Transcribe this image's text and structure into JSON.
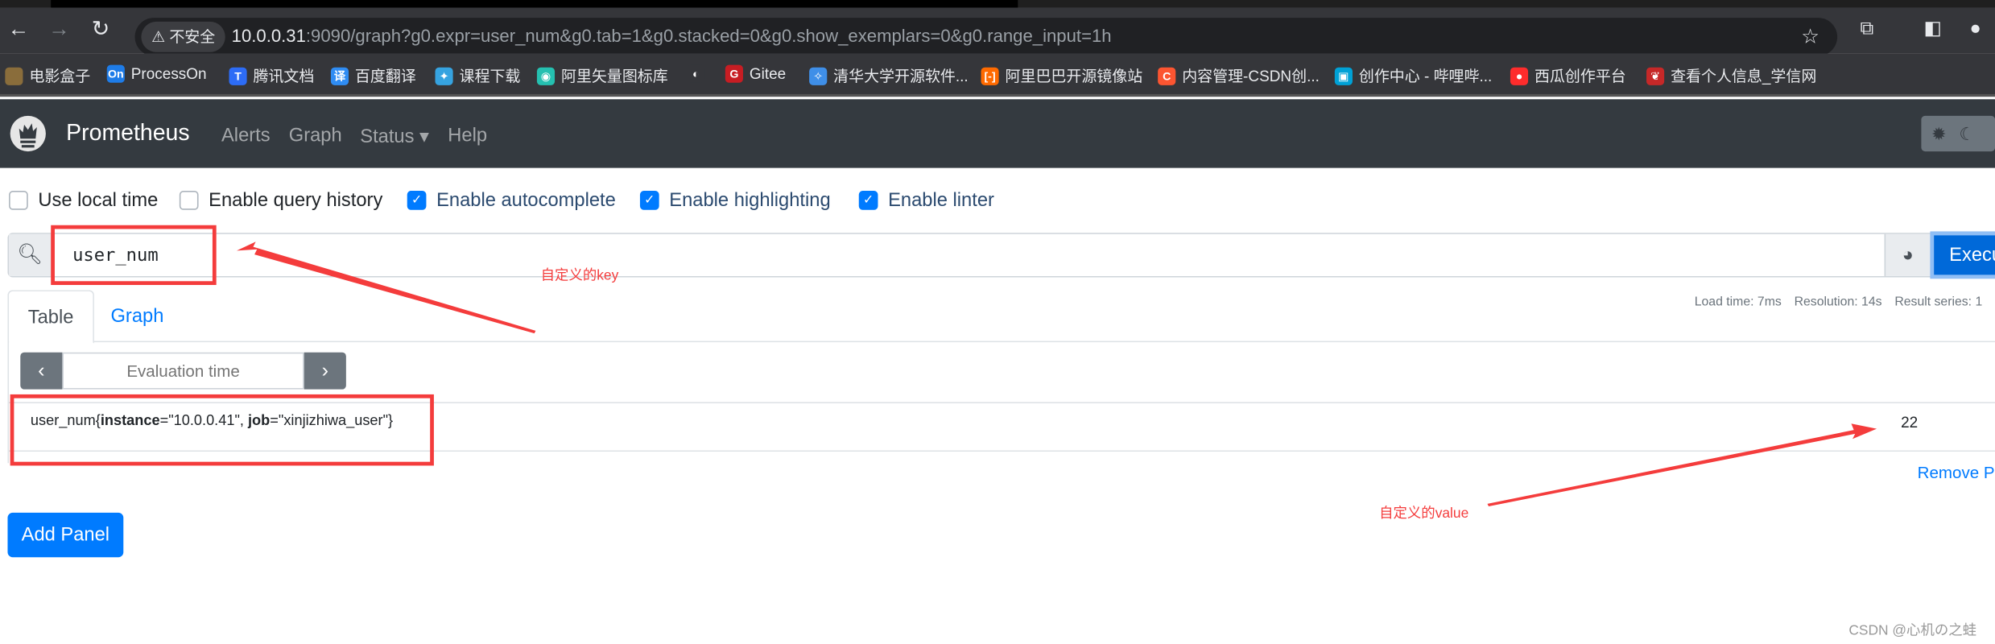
{
  "browser": {
    "security_label": "不安全",
    "url_host": "10.0.0.31",
    "url_rest": ":9090/graph?g0.expr=user_num&g0.tab=1&g0.stacked=0&g0.show_exemplars=0&g0.range_input=1h",
    "bookmarks": [
      {
        "label": "电影盒子",
        "icon": "movie-box-icon",
        "color": "#8a6d3b",
        "glyph": ""
      },
      {
        "label": "ProcessOn",
        "icon": "processon-icon",
        "color": "#1e7ce8",
        "glyph": "On"
      },
      {
        "label": "腾讯文档",
        "icon": "tencent-docs-icon",
        "color": "#2d6cf6",
        "glyph": "T"
      },
      {
        "label": "百度翻译",
        "icon": "baidu-translate-icon",
        "color": "#2f8cf3",
        "glyph": "译"
      },
      {
        "label": "课程下载",
        "icon": "course-download-icon",
        "color": "#36a3e0",
        "glyph": "✦"
      },
      {
        "label": "阿里矢量图标库",
        "icon": "iconfont-icon",
        "color": "#25c0b0",
        "glyph": "◉"
      },
      {
        "label": "",
        "icon": "globe-icon",
        "color": "#35363a",
        "glyph": "◐"
      },
      {
        "label": "Gitee",
        "icon": "gitee-icon",
        "color": "#c71d23",
        "glyph": "G"
      },
      {
        "label": "清华大学开源软件...",
        "icon": "tsinghua-mirror-icon",
        "color": "#3f8fe8",
        "glyph": "✧"
      },
      {
        "label": "阿里巴巴开源镜像站",
        "icon": "aliyun-icon",
        "color": "#ff6a00",
        "glyph": "[-]"
      },
      {
        "label": "内容管理-CSDN创...",
        "icon": "csdn-icon",
        "color": "#fc5531",
        "glyph": "C"
      },
      {
        "label": "创作中心 - 哔哩哔...",
        "icon": "bilibili-icon",
        "color": "#00a1d6",
        "glyph": "▣"
      },
      {
        "label": "西瓜创作平台",
        "icon": "xigua-icon",
        "color": "#fe2c2c",
        "glyph": "●"
      },
      {
        "label": "查看个人信息_学信网",
        "icon": "chsi-icon",
        "color": "#c62828",
        "glyph": "❦"
      }
    ]
  },
  "nav": {
    "brand": "Prometheus",
    "links": [
      "Alerts",
      "Graph",
      "Status ▾",
      "Help"
    ]
  },
  "options": [
    {
      "label": "Use local time",
      "checked": false
    },
    {
      "label": "Enable query history",
      "checked": false
    },
    {
      "label": "Enable autocomplete",
      "checked": true
    },
    {
      "label": "Enable highlighting",
      "checked": true
    },
    {
      "label": "Enable linter",
      "checked": true
    }
  ],
  "query": {
    "value": "user_num",
    "execute_label": "Execute"
  },
  "tabs": {
    "table": "Table",
    "graph": "Graph",
    "active": "Table"
  },
  "stats": {
    "load_time": "Load time: 7ms",
    "resolution": "Resolution: 14s",
    "result_series": "Result series: 1"
  },
  "eval": {
    "placeholder": "Evaluation time"
  },
  "result": {
    "metric": "user_num",
    "labels": [
      {
        "key": "instance",
        "value": "\"10.0.0.41\""
      },
      {
        "key": "job",
        "value": "\"xinjizhiwa_user\""
      }
    ],
    "value": "22"
  },
  "remove_panel": "Remove Panel",
  "add_panel": "Add Panel",
  "annotations": {
    "key": "自定义的key",
    "value": "自定义的value",
    "color": "#f43c3c"
  },
  "watermark": "CSDN @心机の之蛙"
}
